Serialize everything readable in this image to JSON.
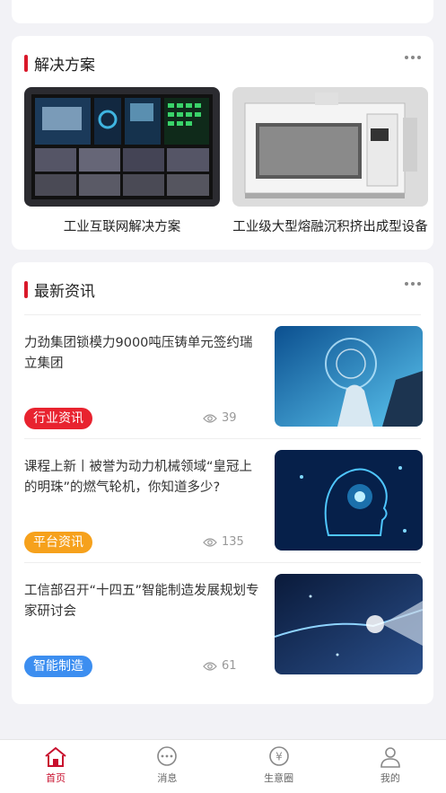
{
  "solutions": {
    "title": "解决方案",
    "items": [
      {
        "label": "工业互联网解决方案"
      },
      {
        "label": "工业级大型熔融沉积挤出成型设备"
      }
    ]
  },
  "news": {
    "title": "最新资讯",
    "items": [
      {
        "title": "力劲集团锁模力9000吨压铸单元签约瑞立集团",
        "tag": "行业资讯",
        "tag_color": "#e8232f",
        "views": "39"
      },
      {
        "title": "课程上新丨被誉为动力机械领域“皇冠上的明珠”的燃气轮机，你知道多少?",
        "tag": "平台资讯",
        "tag_color": "#f6a11c",
        "views": "135"
      },
      {
        "title": "工信部召开“十四五”智能制造发展规划专家研讨会",
        "tag": "智能制造",
        "tag_color": "#3c8ef0",
        "views": "61"
      }
    ]
  },
  "tabbar": {
    "items": [
      {
        "label": "首页",
        "icon": "home-icon",
        "active": true
      },
      {
        "label": "消息",
        "icon": "chat-icon",
        "active": false
      },
      {
        "label": "生意圈",
        "icon": "yuan-icon",
        "active": false
      },
      {
        "label": "我的",
        "icon": "user-icon",
        "active": false
      }
    ]
  },
  "colors": {
    "accent": "#c8102e",
    "background": "#f2f2f6"
  }
}
